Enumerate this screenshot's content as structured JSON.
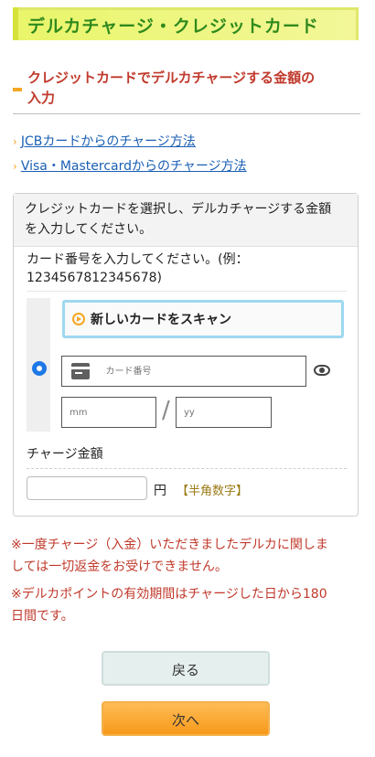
{
  "header": {
    "title": "デルカチャージ・クレジットカード"
  },
  "section": {
    "heading_line1": "クレジットカードでデルカチャージする金額の",
    "heading_line2": "入力"
  },
  "links": [
    {
      "label": "JCBカードからのチャージ方法"
    },
    {
      "label": "Visa・Mastercardからのチャージ方法"
    }
  ],
  "form": {
    "intro_line1": "クレジットカードを選択し、デルカチャージする金額",
    "intro_line2": "を入力してください。",
    "card_instruction_line1": "カード番号を入力してください。(例：",
    "card_instruction_line2": "1234567812345678)",
    "scan_button_label": "新しいカードをスキャン",
    "card_number_placeholder": "カード番号",
    "expiry_month_placeholder": "mm",
    "expiry_year_placeholder": "yy",
    "expiry_separator": "/",
    "charge_amount_label": "チャージ金額",
    "currency_unit": "円",
    "amount_hint": "【半角数字】"
  },
  "notices": [
    "※一度チャージ（入金）いただきましたデルカに関しま",
    "しては一切返金をお受けできません。",
    "※デルカポイントの有効期間はチャージした日から180",
    "日間です。"
  ],
  "buttons": {
    "back": "戻る",
    "next": "次へ"
  },
  "colors": {
    "title_bg": "#e9f56a",
    "title_text": "#2f8a1d",
    "accent": "#f5a623",
    "notice_red": "#c0392b",
    "link_blue": "#1a5fb4",
    "radio_blue": "#1e78e6"
  }
}
